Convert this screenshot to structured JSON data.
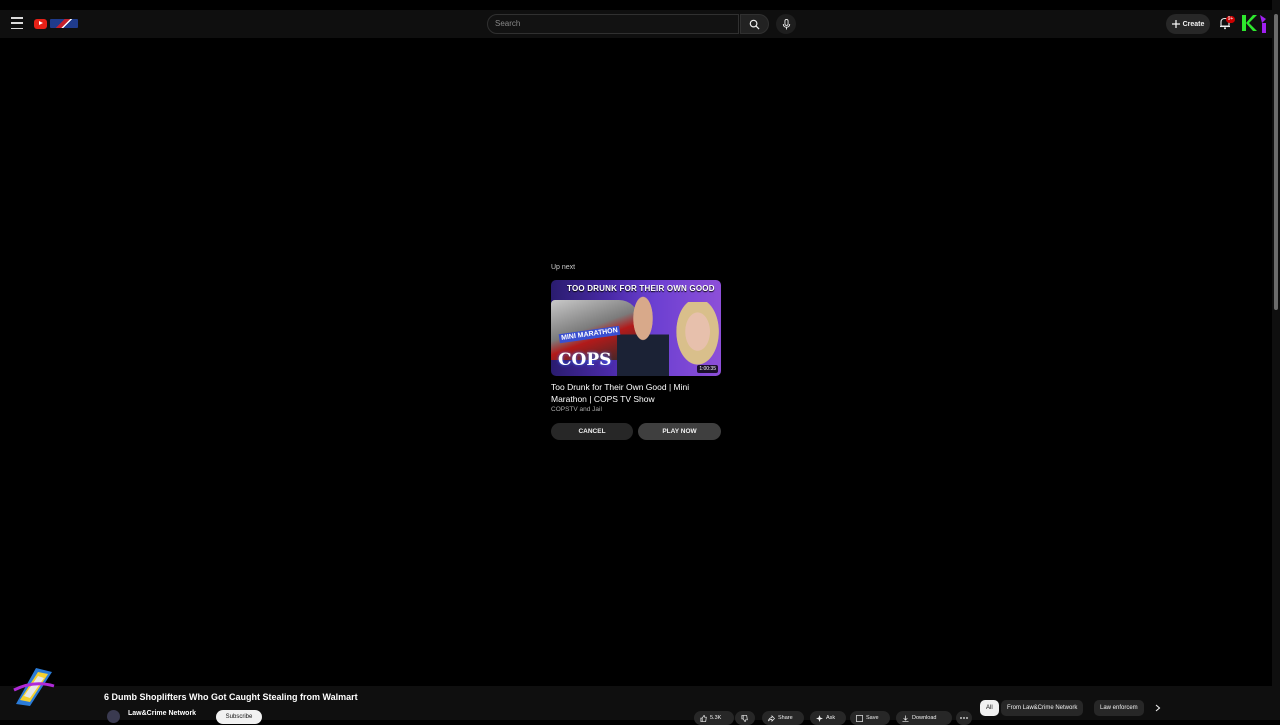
{
  "header": {
    "search_placeholder": "Search",
    "create_label": "Create",
    "notification_count": "9+"
  },
  "up_next": {
    "label": "Up next",
    "thumbnail_headline": "TOO DRUNK FOR THEIR OWN GOOD",
    "thumbnail_mini": "MINI MARATHON",
    "thumbnail_cops": "COPS",
    "duration": "1:00:35",
    "title": "Too Drunk for Their Own Good | Mini Marathon | COPS TV Show",
    "channel": "COPSTV and Jail",
    "cancel_label": "CANCEL",
    "play_now_label": "PLAY NOW"
  },
  "video": {
    "title": "6 Dumb Shoplifters Who Got Caught Stealing from Walmart",
    "channel_name": "Law&Crime Network",
    "subscribe_label": "Subscribe",
    "like_count": "5.3K",
    "share_label": "Share",
    "ask_label": "Ask",
    "save_label": "Save",
    "download_label": "Download"
  },
  "chips": [
    "All",
    "From Law&Crime Network",
    "Law enforcem"
  ],
  "colors": {
    "background": "#000000",
    "youtube_red": "#e62117",
    "k_badge": "#2ee82e"
  }
}
